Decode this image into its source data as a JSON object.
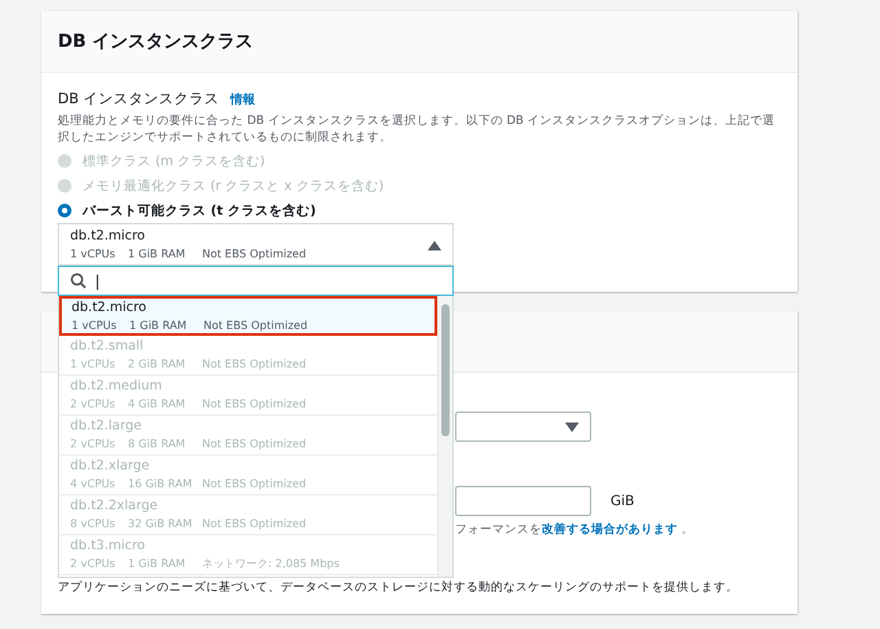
{
  "card_1": {
    "title": "DB インスタンスクラス",
    "field_label": "DB インスタンスクラス",
    "info_link": "情報",
    "description": "処理能力とメモリの要件に合った DB インスタンスクラスを選択します。以下の DB インスタンスクラスオプションは、上記で選択したエンジンでサポートされているものに制限されます。",
    "radios": [
      {
        "label": "標準クラス (m クラスを含む)",
        "selected": false,
        "disabled": true
      },
      {
        "label": "メモリ最適化クラス (r クラスと x クラスを含む)",
        "selected": false,
        "disabled": true
      },
      {
        "label": "バースト可能クラス (t クラスを含む)",
        "selected": true,
        "disabled": false
      }
    ]
  },
  "dropdown": {
    "value": {
      "name": "db.t2.micro",
      "vcpus": "1 vCPUs",
      "ram": "1 GiB RAM",
      "extra": "Not EBS Optimized"
    },
    "expanded": true,
    "search": {
      "value": "|"
    },
    "options": [
      {
        "name": "db.t2.micro",
        "vcpus": "1 vCPUs",
        "ram": "1 GiB RAM",
        "extra": "Not EBS Optimized",
        "selected": true,
        "disabled": false
      },
      {
        "name": "db.t2.small",
        "vcpus": "1 vCPUs",
        "ram": "2 GiB RAM",
        "extra": "Not EBS Optimized",
        "selected": false,
        "disabled": true
      },
      {
        "name": "db.t2.medium",
        "vcpus": "2 vCPUs",
        "ram": "4 GiB RAM",
        "extra": "Not EBS Optimized",
        "selected": false,
        "disabled": true
      },
      {
        "name": "db.t2.large",
        "vcpus": "2 vCPUs",
        "ram": "8 GiB RAM",
        "extra": "Not EBS Optimized",
        "selected": false,
        "disabled": true
      },
      {
        "name": "db.t2.xlarge",
        "vcpus": "4 vCPUs",
        "ram": "16 GiB RAM",
        "extra": "Not EBS Optimized",
        "selected": false,
        "disabled": true
      },
      {
        "name": "db.t2.2xlarge",
        "vcpus": "8 vCPUs",
        "ram": "32 GiB RAM",
        "extra": "Not EBS Optimized",
        "selected": false,
        "disabled": true
      },
      {
        "name": "db.t3.micro",
        "vcpus": "2 vCPUs",
        "ram": "1 GiB RAM",
        "extra": "ネットワーク: 2,085 Mbps",
        "selected": false,
        "disabled": true
      }
    ]
  },
  "card_2": {
    "unit": "GiB",
    "hint": "フォーマンスを",
    "hint_link": "改善する場合があります",
    "hint_end": " 。",
    "description": "アプリケーションのニーズに基づいて、データベースのストレージに対する動的なスケーリングのサポートを提供します。"
  }
}
